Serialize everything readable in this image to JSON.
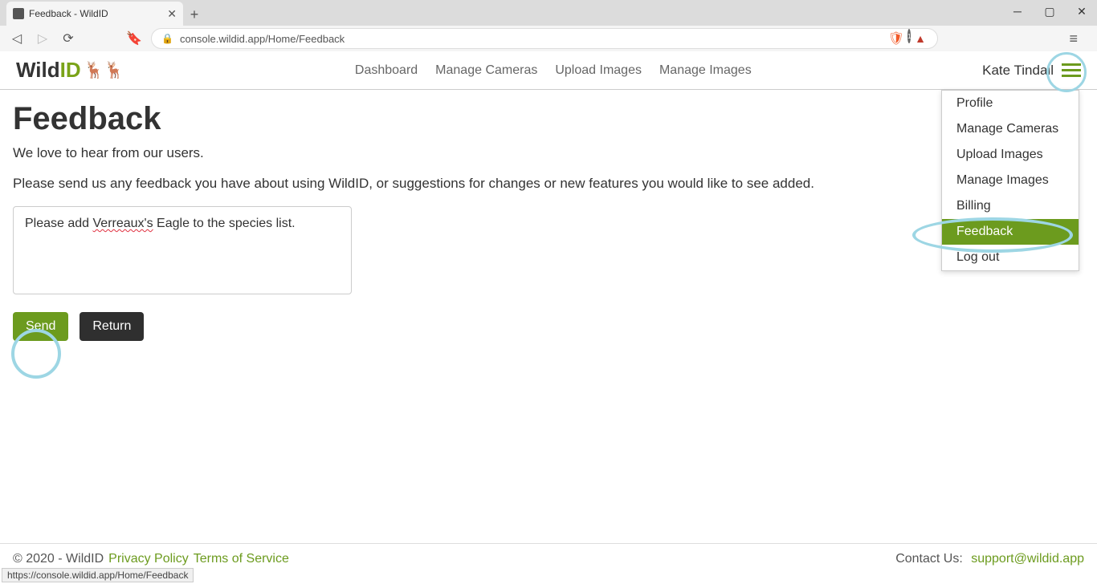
{
  "browser": {
    "tab_title": "Feedback - WildID",
    "url": "console.wildid.app/Home/Feedback",
    "brave_badge": "1"
  },
  "logo": {
    "wild": "Wild",
    "id": "ID"
  },
  "nav": {
    "dashboard": "Dashboard",
    "manage_cameras": "Manage Cameras",
    "upload_images": "Upload Images",
    "manage_images": "Manage Images"
  },
  "user_name": "Kate Tindall",
  "dropdown": {
    "profile": "Profile",
    "manage_cameras": "Manage Cameras",
    "upload_images": "Upload Images",
    "manage_images": "Manage Images",
    "billing": "Billing",
    "feedback": "Feedback",
    "logout": "Log out"
  },
  "page": {
    "title": "Feedback",
    "intro": "We love to hear from our users.",
    "instructions": "Please send us any feedback you have about using WildID, or suggestions for changes or new features you would like to see added.",
    "textarea_prefix": "Please add ",
    "textarea_spell": "Verreaux's",
    "textarea_suffix": " Eagle to the species list.",
    "send": "Send",
    "return": "Return"
  },
  "footer": {
    "copyright": "© 2020 - WildID  ",
    "privacy": "Privacy Policy",
    "terms": "Terms of Service",
    "contact_label": "Contact Us: ",
    "contact_email": "support@wildid.app"
  },
  "status_bar": "https://console.wildid.app/Home/Feedback"
}
